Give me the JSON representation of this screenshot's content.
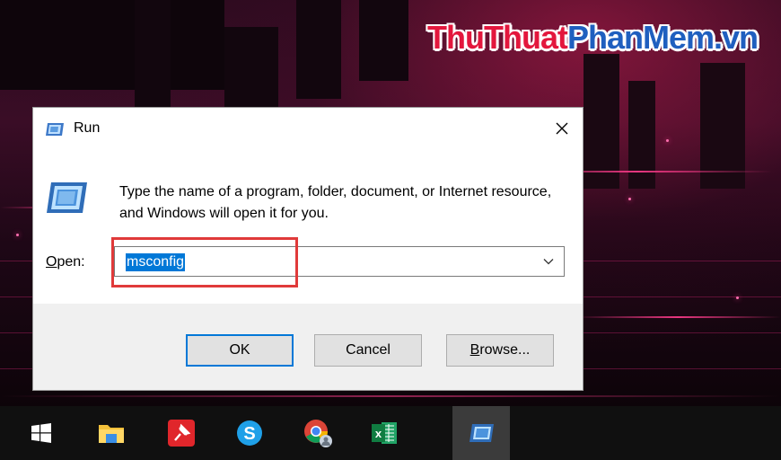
{
  "watermark": {
    "part1": "ThuThuat",
    "part2": "PhanMem.vn"
  },
  "dialog": {
    "title": "Run",
    "description": "Type the name of a program, folder, document, or Internet resource, and Windows will open it for you.",
    "open_label_accel": "O",
    "open_label_rest": "pen:",
    "open_value": "msconfig",
    "buttons": {
      "ok": "OK",
      "cancel": "Cancel",
      "browse_accel": "B",
      "browse_rest": "rowse..."
    }
  },
  "colors": {
    "accent": "#0078d7",
    "highlight_box": "#e03a3a"
  },
  "taskbar": {
    "items": [
      {
        "icon": "windows-start-icon"
      },
      {
        "icon": "file-explorer-icon"
      },
      {
        "icon": "pinned-app-icon"
      },
      {
        "icon": "skype-icon"
      },
      {
        "icon": "chrome-icon"
      },
      {
        "icon": "excel-icon"
      },
      {
        "icon": "run-icon",
        "active": true
      }
    ]
  }
}
